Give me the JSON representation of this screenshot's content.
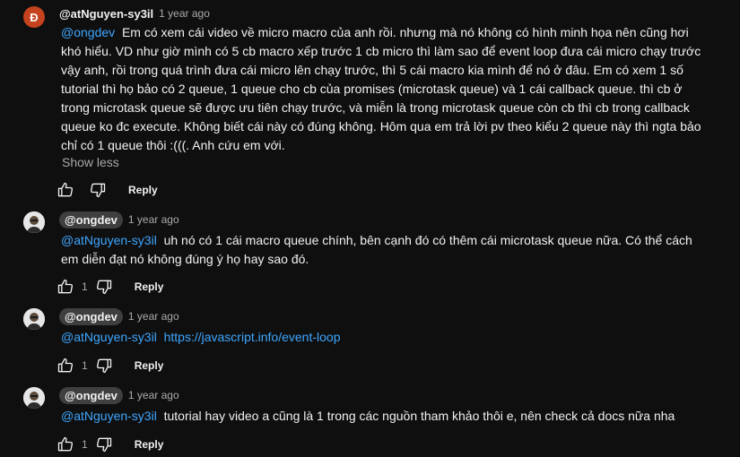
{
  "comments": [
    {
      "avatar_letter": "Đ",
      "author": "@atNguyen-sy3il",
      "time": "1 year ago",
      "mention": "@ongdev",
      "lines": [
        "Em có xem cái video về micro macro của anh rồi. nhưng mà nó không có hình minh họa nên cũng hơi",
        "khó hiểu. VD như giờ mình có 5 cb macro xếp trước 1 cb micro thì làm sao để event loop đưa cái micro chạy trước",
        "vậy anh, rồi trong quá trình đưa cái micro lên chạy trước, thì 5 cái macro kia mình để nó ở đâu. Em có xem 1 số",
        "tutorial thì họ bảo có 2 queue, 1 queue cho cb của promises (microtask queue) và 1 cái callback queue. thì cb ở",
        "trong microtask queue sẽ được ưu tiên chạy trước, và miễn là trong microtask queue còn cb thì cb trong callback",
        "queue ko đc execute. Không biết cái này có đúng không. Hôm qua em trả lời pv theo kiểu 2 queue này thì ngta bảo",
        "chỉ có 1 queue thôi :(((. Anh cứu em với."
      ],
      "show_less": "Show less",
      "likes": "",
      "reply": "Reply"
    },
    {
      "author": "@ongdev",
      "time": "1 year ago",
      "mention": "@atNguyen-sy3il",
      "lines": [
        "uh nó có 1 cái macro queue chính, bên cạnh đó có thêm cái microtask queue nữa. Có thể cách",
        "em diễn đạt nó không đúng ý họ hay sao đó."
      ],
      "likes": "1",
      "reply": "Reply"
    },
    {
      "author": "@ongdev",
      "time": "1 year ago",
      "mention": "@atNguyen-sy3il",
      "link": "https://javascript.info/event-loop",
      "likes": "1",
      "reply": "Reply"
    },
    {
      "author": "@ongdev",
      "time": "1 year ago",
      "mention": "@atNguyen-sy3il",
      "lines": [
        "tutorial hay video a cũng là 1 trong các nguồn tham khảo thôi e, nên check cả docs nữa nha"
      ],
      "likes": "1",
      "reply": "Reply"
    }
  ],
  "icons": {
    "like": "thumbs-up-outline",
    "dislike": "thumbs-down-outline"
  },
  "colors": {
    "background": "#0f0f0f",
    "text": "#f1f1f1",
    "secondary": "#aaaaaa",
    "mention": "#3ea6ff",
    "avatar_accent": "#c5431f",
    "author_chip": "#3f3f3f"
  }
}
